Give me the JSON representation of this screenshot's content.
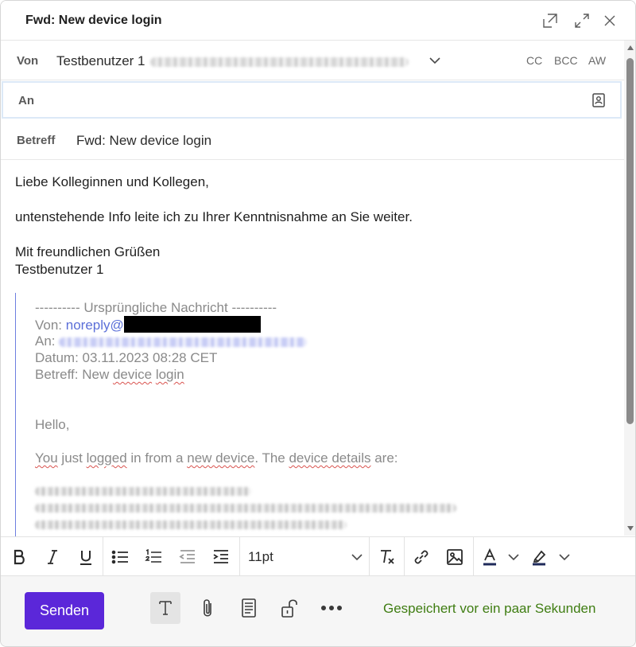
{
  "window": {
    "title": "Fwd: New device login"
  },
  "header": {
    "from_label": "Von",
    "from_name": "Testbenutzer 1",
    "cc_label": "CC",
    "bcc_label": "BCC",
    "aw_label": "AW",
    "to_label": "An",
    "subject_label": "Betreff",
    "subject_value": "Fwd: New device login"
  },
  "body": {
    "greeting": "Liebe Kolleginnen und Kollegen,",
    "line1": "untenstehende Info leite ich zu Ihrer Kenntnisnahme an Sie weiter.",
    "closing": "Mit freundlichen Grüßen",
    "signature": "Testbenutzer 1",
    "quoted": {
      "separator": "---------- Ursprüngliche Nachricht ----------",
      "from_prefix": "Von: ",
      "from_link": "noreply@",
      "to_prefix": "An: ",
      "date": "Datum: 03.11.2023 08:28 CET",
      "subject_prefix": "Betreff: New ",
      "subject_device": "device",
      "subject_login": "login",
      "hello": "Hello,",
      "text_you": "You",
      "text_mid1": " just ",
      "text_logged": "logged",
      "text_mid2": " in from a ",
      "text_new": "new device",
      "text_mid3": ". The ",
      "text_details": "device details",
      "text_end": " are:"
    }
  },
  "toolbar": {
    "font_size": "11pt"
  },
  "footer": {
    "send_label": "Senden",
    "saved_status": "Gespeichert vor ein paar Sekunden"
  },
  "colors": {
    "accent": "#5b27d9",
    "saved_text": "#3f7d12",
    "link": "#5b6fd8",
    "focus_border": "#dce9f7"
  }
}
